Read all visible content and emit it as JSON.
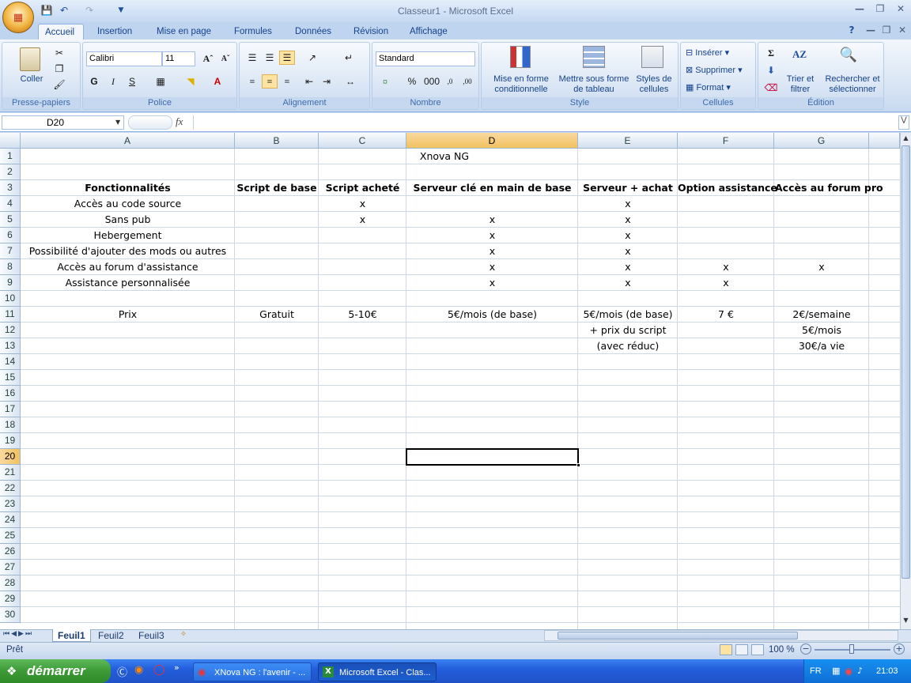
{
  "window": {
    "title": "Classeur1 - Microsoft Excel"
  },
  "ribbon_tabs": [
    "Accueil",
    "Insertion",
    "Mise en page",
    "Formules",
    "Données",
    "Révision",
    "Affichage"
  ],
  "ribbon": {
    "clipboard": {
      "paste": "Coller",
      "label": "Presse-papiers"
    },
    "font": {
      "name": "Calibri",
      "size": "11",
      "bold": "G",
      "italic": "I",
      "underline": "S",
      "label": "Police"
    },
    "alignment": {
      "label": "Alignement"
    },
    "number": {
      "format": "Standard",
      "percent": "%",
      "thousands": "000",
      "label": "Nombre"
    },
    "style": {
      "cond_format": "Mise en forme conditionnelle",
      "table_format": "Mettre sous forme de tableau",
      "cell_styles": "Styles de cellules",
      "label": "Style"
    },
    "cells": {
      "insert": "Insérer",
      "delete": "Supprimer",
      "format": "Format",
      "label": "Cellules"
    },
    "editing": {
      "sort": "Trier et filtrer",
      "find": "Rechercher et sélectionner",
      "label": "Édition"
    }
  },
  "formula_bar": {
    "name_box": "D20",
    "fx": "fx",
    "value": ""
  },
  "columns": [
    "A",
    "B",
    "C",
    "D",
    "E",
    "F",
    "G"
  ],
  "selected_column": "D",
  "selected_row": "20",
  "rows": [
    "1",
    "2",
    "3",
    "4",
    "5",
    "6",
    "7",
    "8",
    "9",
    "10",
    "11",
    "12",
    "13",
    "14",
    "15",
    "16",
    "17",
    "18",
    "19",
    "20",
    "21",
    "22",
    "23",
    "24",
    "25",
    "26",
    "27",
    "28",
    "29",
    "30"
  ],
  "cells": {
    "D1": "Xnova NG",
    "A3": "Fonctionnalités",
    "B3": "Script de base",
    "C3": "Script acheté",
    "D3": "Serveur clé en main de base",
    "E3": "Serveur + achat",
    "F3": "Option assistance",
    "G3": "Accès au forum pro",
    "A4": "Accès au code source",
    "C4": "x",
    "E4": "x",
    "A5": "Sans pub",
    "C5": "x",
    "D5": "x",
    "E5": "x",
    "A6": "Hebergement",
    "D6": "x",
    "E6": "x",
    "A7": "Possibilité d'ajouter des mods ou autres",
    "D7": "x",
    "E7": "x",
    "A8": "Accès au forum d'assistance",
    "D8": "x",
    "E8": "x",
    "F8": "x",
    "G8": "x",
    "A9": "Assistance personnalisée",
    "D9": "x",
    "E9": "x",
    "F9": "x",
    "A11": "Prix",
    "B11": "Gratuit",
    "C11": "5-10€",
    "D11": "5€/mois (de base)",
    "E11": "5€/mois (de base)",
    "F11": "7 €",
    "G11": "2€/semaine",
    "E12": "+ prix du script",
    "G12": "5€/mois",
    "E13": "(avec réduc)",
    "G13": "30€/a vie"
  },
  "sheets": [
    "Feuil1",
    "Feuil2",
    "Feuil3"
  ],
  "active_sheet": "Feuil1",
  "status": {
    "ready": "Prêt",
    "zoom": "100 %"
  },
  "taskbar": {
    "start": "démarrer",
    "tasks": [
      "XNova NG : l'avenir - ...",
      "Microsoft Excel - Clas..."
    ],
    "lang": "FR",
    "clock": "21:03"
  }
}
